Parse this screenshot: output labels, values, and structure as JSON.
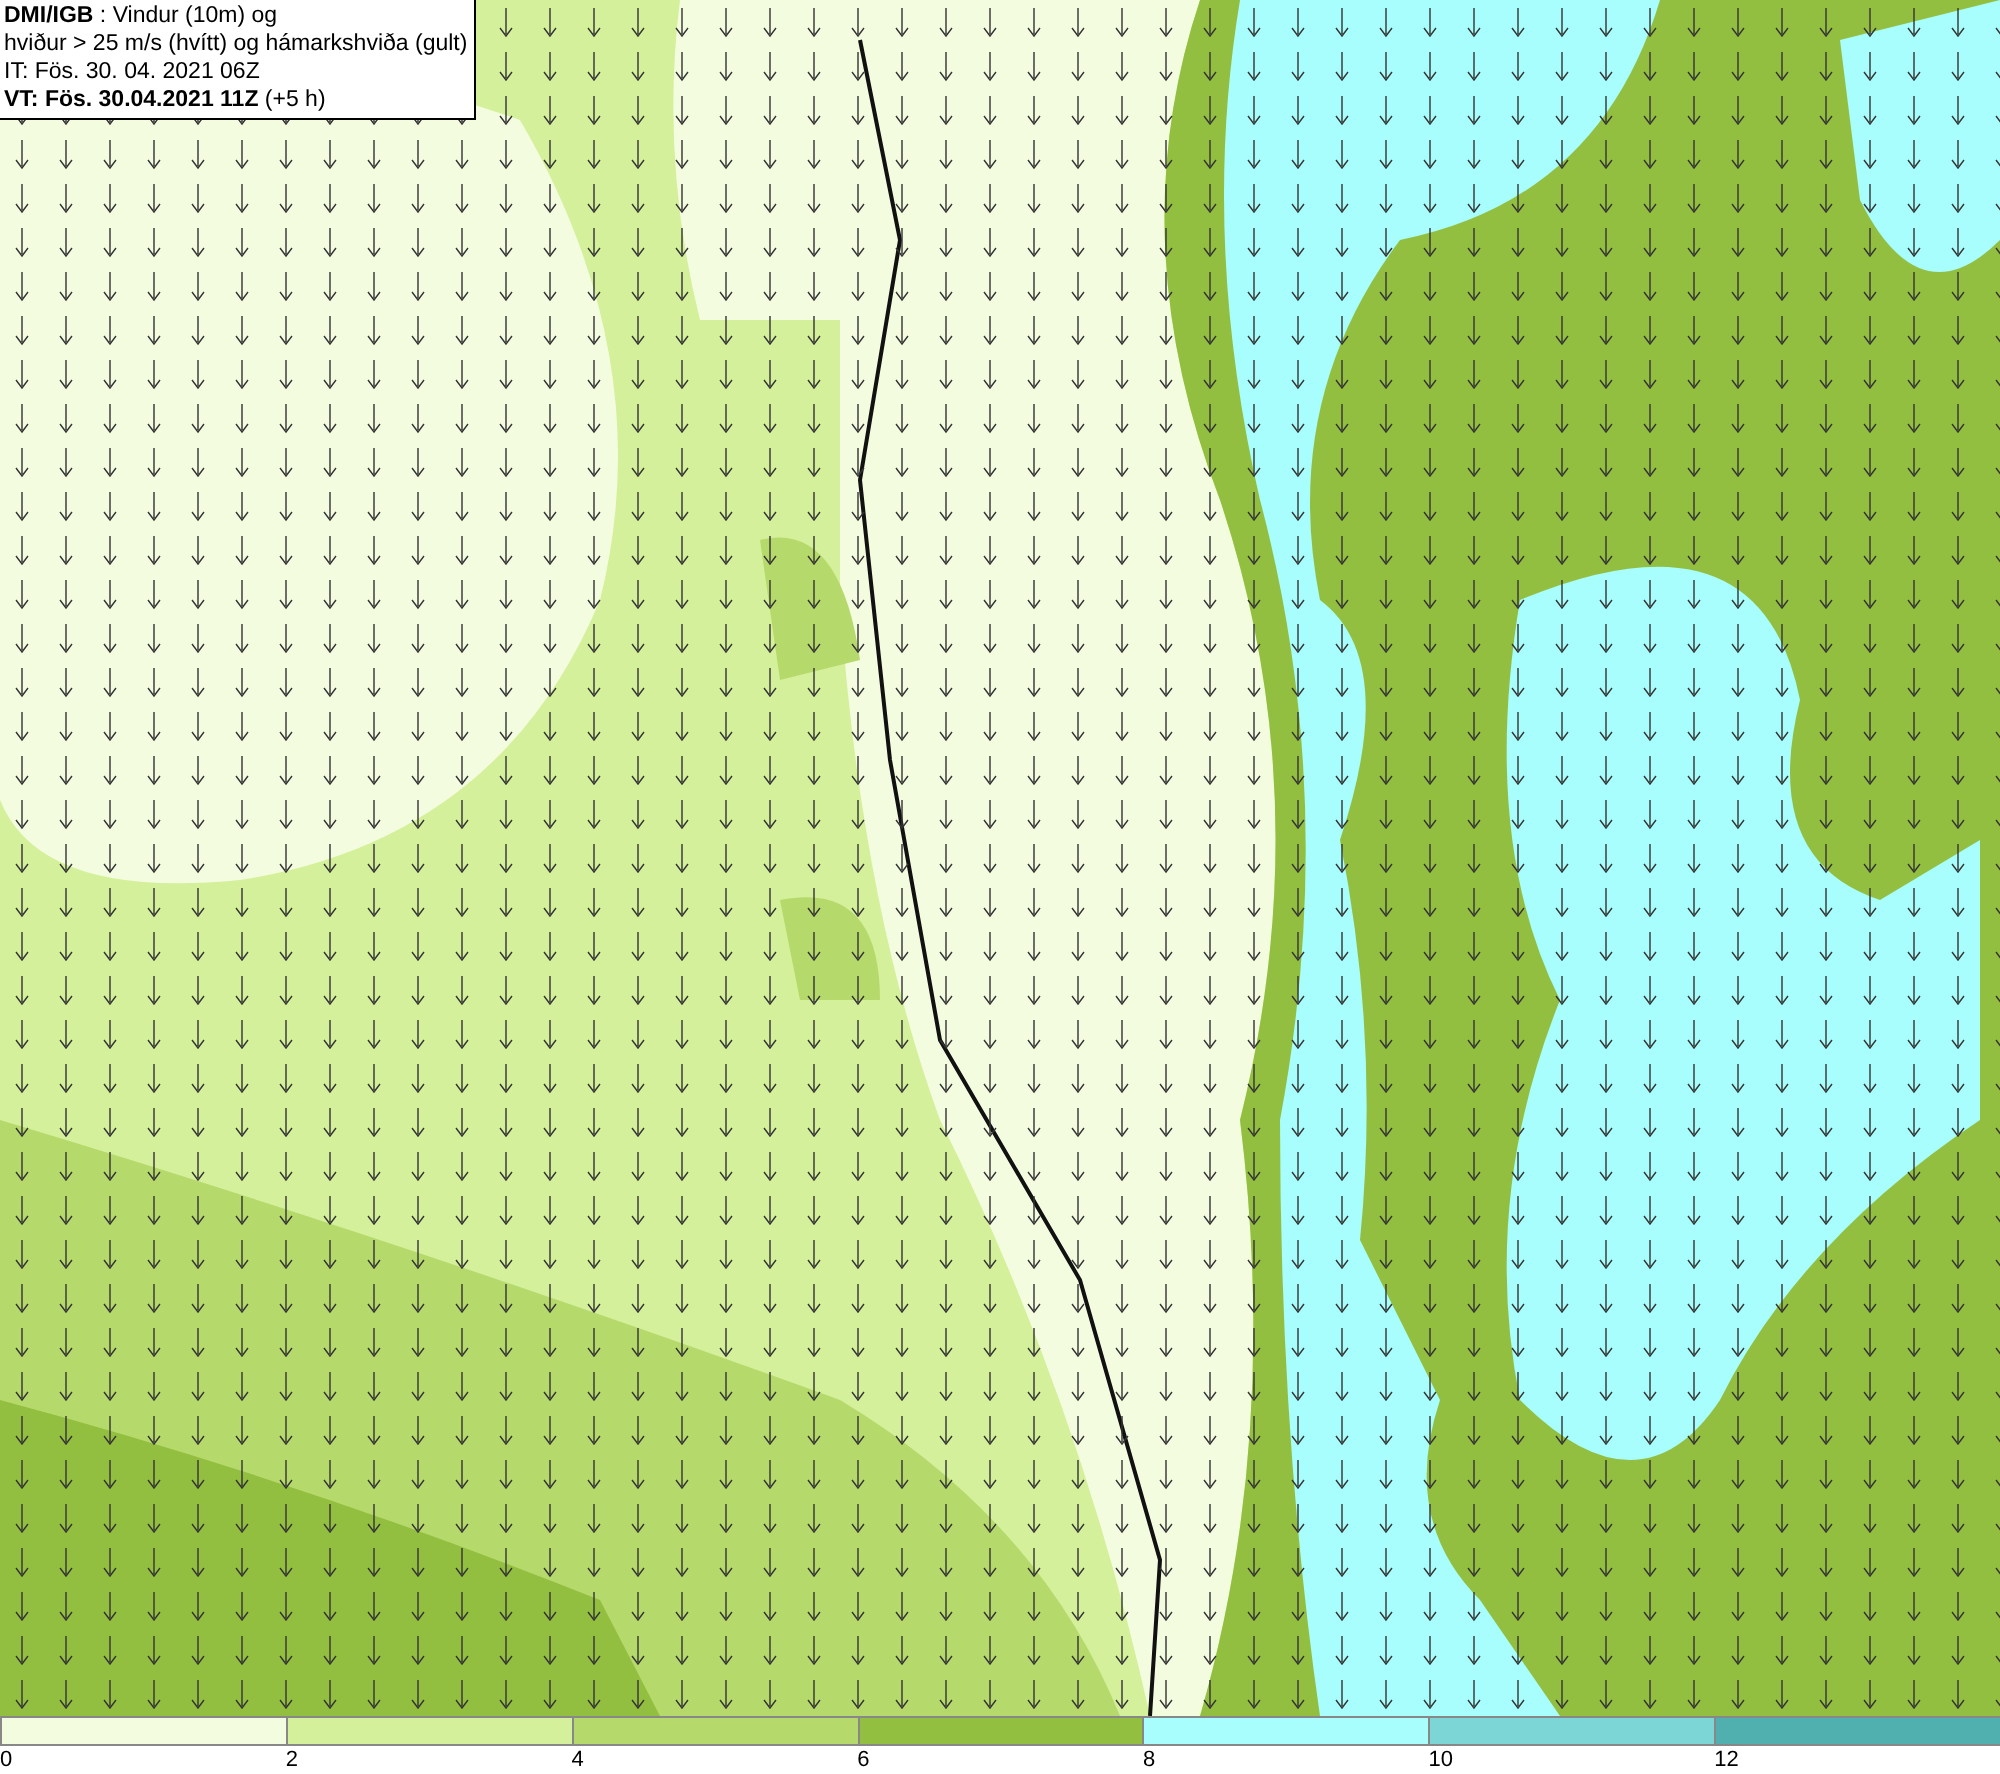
{
  "header": {
    "lines": [
      "**DMI/IGB** : Vindur (10m) og",
      "hviður > 25 m/s (hvítt) og hámarkshviða (gult)",
      "IT: Fös. 30. 04. 2021 06Z",
      "**VT: Fös. 30.04.2021 11Z** (+5 h)"
    ]
  },
  "legend": [
    {
      "label": "0",
      "color": "#f4fce0"
    },
    {
      "label": "2",
      "color": "#d4f09a"
    },
    {
      "label": "4",
      "color": "#b6d96c"
    },
    {
      "label": "6",
      "color": "#93bf40"
    },
    {
      "label": "8",
      "color": "#a8fdfd"
    },
    {
      "label": "10",
      "color": "#7dd6d6"
    },
    {
      "label": "12",
      "color": "#50b0b0"
    }
  ]
}
